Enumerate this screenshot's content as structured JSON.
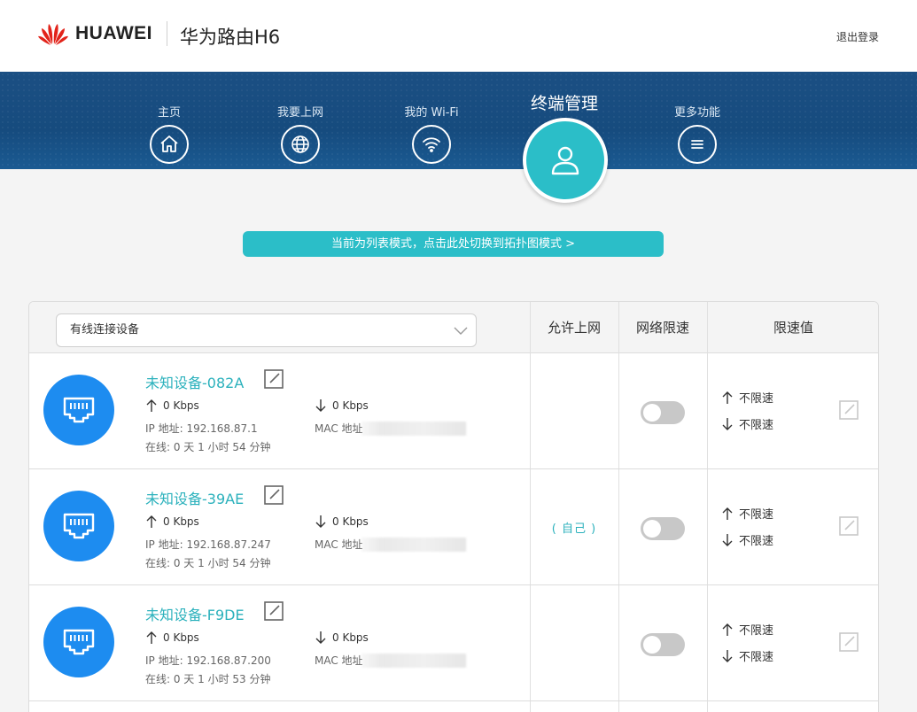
{
  "header": {
    "brand": "HUAWEI",
    "product": "华为路由H6",
    "logout_label": "退出登录"
  },
  "nav": {
    "items": [
      {
        "label": "主页",
        "icon": "home-icon"
      },
      {
        "label": "我要上网",
        "icon": "globe-icon"
      },
      {
        "label": "我的 Wi-Fi",
        "icon": "wifi-icon"
      },
      {
        "label": "终端管理",
        "icon": "user-icon",
        "active": true
      },
      {
        "label": "更多功能",
        "icon": "menu-icon"
      }
    ]
  },
  "mode_switch_label": "当前为列表模式，点击此处切换到拓扑图模式 >",
  "table": {
    "filter_value": "有线连接设备",
    "columns": [
      "允许上网",
      "网络限速",
      "限速值"
    ],
    "rows": [
      {
        "name": "未知设备-082A",
        "up_rate": "0 Kbps",
        "down_rate": "0 Kbps",
        "ip": "IP 地址: 192.168.87.1",
        "mac_label": "MAC 地址",
        "online": "在线: 0 天 1 小时 54 分钟",
        "allow": "",
        "speed_limit_enabled": false,
        "up_limit": "不限速",
        "down_limit": "不限速"
      },
      {
        "name": "未知设备-39AE",
        "up_rate": "0 Kbps",
        "down_rate": "0 Kbps",
        "ip": "IP 地址: 192.168.87.247",
        "mac_label": "MAC 地址",
        "online": "在线: 0 天 1 小时 54 分钟",
        "allow": "( 自己 )",
        "speed_limit_enabled": false,
        "up_limit": "不限速",
        "down_limit": "不限速"
      },
      {
        "name": "未知设备-F9DE",
        "up_rate": "0 Kbps",
        "down_rate": "0 Kbps",
        "ip": "IP 地址: 192.168.87.200",
        "mac_label": "MAC 地址",
        "online": "在线: 0 天 1 小时 53 分钟",
        "allow": "",
        "speed_limit_enabled": false,
        "up_limit": "不限速",
        "down_limit": "不限速"
      }
    ]
  },
  "colors": {
    "accent": "#2bbec8",
    "nav_band": "#164b7e",
    "device_icon": "#1d8cf0",
    "link_text": "#2bb1bc"
  }
}
